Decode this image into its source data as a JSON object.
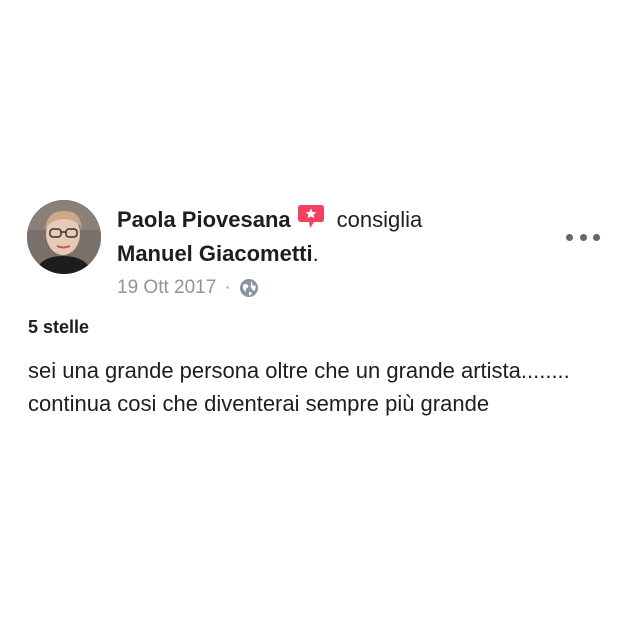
{
  "post": {
    "author": "Paola Piovesana",
    "action": "consiglia",
    "target": "Manuel Giacometti",
    "target_suffix": ".",
    "date": "19 Ott 2017",
    "separator": "·",
    "privacy_icon": "globe-icon",
    "recommend_icon": "recommend-badge-icon",
    "more_icon": "more-options-icon",
    "rating_label": "5 stelle",
    "text": "sei una grande persona oltre che un grande artista........ continua cosi che diventerai sempre più grande"
  },
  "colors": {
    "recommend_badge": "#f3425f",
    "meta_text": "#8d949e",
    "body_text": "#1c1e21"
  }
}
